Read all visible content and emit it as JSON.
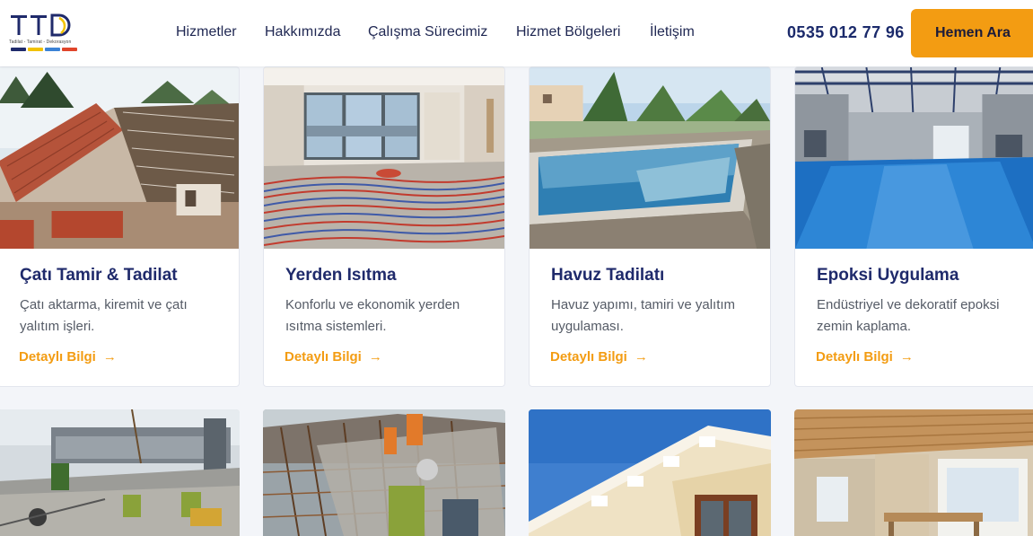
{
  "logo": {
    "letters": "TTD",
    "tagline": "Tadilat - Tamirat - Dekorasyon",
    "bar_colors": [
      "#1f2a6b",
      "#f2c200",
      "#3b82d6",
      "#e0452b"
    ]
  },
  "nav": {
    "items": [
      {
        "label": "Hizmetler"
      },
      {
        "label": "Hakkımızda"
      },
      {
        "label": "Çalışma Sürecimiz"
      },
      {
        "label": "Hizmet Bölgeleri"
      },
      {
        "label": "İletişim"
      }
    ]
  },
  "header": {
    "phone": "0535 012 77 96",
    "cta_label": "Hemen Ara"
  },
  "colors": {
    "accent": "#f39c12",
    "navy": "#1f2a6b",
    "background": "#f3f5f9"
  },
  "services": [
    {
      "title": "Çatı Tamir & Tadilat",
      "description": "Çatı aktarma, kiremit ve çatı yalıtım işleri.",
      "link": "Detaylı Bilgi",
      "link_icon": "arrow-right-icon"
    },
    {
      "title": "Yerden Isıtma",
      "description": "Konforlu ve ekonomik yerden ısıtma sistemleri.",
      "link": "Detaylı Bilgi",
      "link_icon": "arrow-right-icon"
    },
    {
      "title": "Havuz Tadilatı",
      "description": "Havuz yapımı, tamiri ve yalıtım uygulaması.",
      "link": "Detaylı Bilgi",
      "link_icon": "arrow-right-icon"
    },
    {
      "title": "Epoksi Uygulama",
      "description": "Endüstriyel ve dekoratif epoksi zemin kaplama.",
      "link": "Detaylı Bilgi",
      "link_icon": "arrow-right-icon"
    }
  ],
  "arrow_glyph": "→"
}
